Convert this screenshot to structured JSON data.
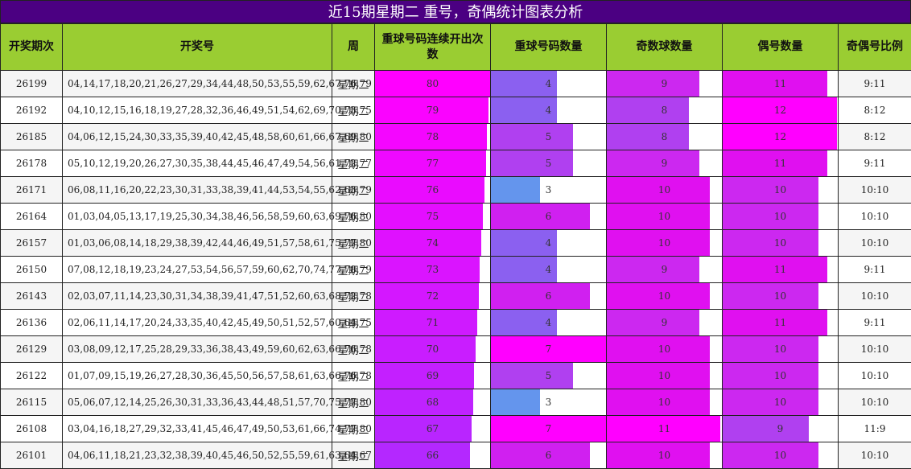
{
  "title": "近15期星期二 重号，奇偶统计图表分析",
  "headers": [
    "开奖期次",
    "开奖号",
    "周",
    "重球号码连续开出次数",
    "重球号码数量",
    "奇数球数量",
    "偶号数量",
    "奇偶号比例"
  ],
  "colors": {
    "title_bg": "#4b0082",
    "header_bg": "#9acd32",
    "magenta": "#ff00ff",
    "violet": "#8a2be2",
    "blue": "#6495ed"
  },
  "chart_data": {
    "type": "table",
    "title": "近15期星期二 重号，奇偶统计图表分析",
    "columns": [
      "开奖期次",
      "开奖号",
      "周",
      "重球号码连续开出次数",
      "重球号码数量",
      "奇数球数量",
      "偶号数量",
      "奇偶号比例"
    ],
    "scales": {
      "consecutive_max": 80,
      "repeat_max": 7,
      "odd_max": 11,
      "even_max": 12
    },
    "rows": [
      {
        "period": "26199",
        "numbers": "04,14,17,18,20,21,26,27,29,34,44,48,50,53,55,59,62,67,76,79",
        "week": "星期二",
        "consecutive": 80,
        "repeat": 4,
        "odd": 9,
        "even": 11,
        "ratio": "9:11"
      },
      {
        "period": "26192",
        "numbers": "04,10,12,15,16,18,19,27,28,32,36,46,49,51,54,62,69,70,73,75",
        "week": "星期二",
        "consecutive": 79,
        "repeat": 4,
        "odd": 8,
        "even": 12,
        "ratio": "8:12"
      },
      {
        "period": "26185",
        "numbers": "04,06,12,15,24,30,33,35,39,40,42,45,48,58,60,61,66,67,69,80",
        "week": "星期二",
        "consecutive": 78,
        "repeat": 5,
        "odd": 8,
        "even": 12,
        "ratio": "8:12"
      },
      {
        "period": "26178",
        "numbers": "05,10,12,19,20,26,27,30,35,38,44,45,46,47,49,54,56,61,72,77",
        "week": "星期二",
        "consecutive": 77,
        "repeat": 5,
        "odd": 9,
        "even": 11,
        "ratio": "9:11"
      },
      {
        "period": "26171",
        "numbers": "06,08,11,16,20,22,23,30,31,33,38,39,41,44,53,54,55,62,63,79",
        "week": "星期二",
        "consecutive": 76,
        "repeat": 3,
        "odd": 10,
        "even": 10,
        "ratio": "10:10"
      },
      {
        "period": "26164",
        "numbers": "01,03,04,05,13,17,19,25,30,34,38,46,56,58,59,60,63,69,76,80",
        "week": "星期二",
        "consecutive": 75,
        "repeat": 6,
        "odd": 10,
        "even": 10,
        "ratio": "10:10"
      },
      {
        "period": "26157",
        "numbers": "01,03,06,08,14,18,29,38,39,42,44,46,49,51,57,58,61,75,77,80",
        "week": "星期二",
        "consecutive": 74,
        "repeat": 4,
        "odd": 10,
        "even": 10,
        "ratio": "10:10"
      },
      {
        "period": "26150",
        "numbers": "07,08,12,18,19,23,24,27,53,54,56,57,59,60,62,70,74,77,78,79",
        "week": "星期二",
        "consecutive": 73,
        "repeat": 4,
        "odd": 9,
        "even": 11,
        "ratio": "9:11"
      },
      {
        "period": "26143",
        "numbers": "02,03,07,11,14,23,30,31,34,38,39,41,47,51,52,60,63,68,72,78",
        "week": "星期二",
        "consecutive": 72,
        "repeat": 6,
        "odd": 10,
        "even": 10,
        "ratio": "10:10"
      },
      {
        "period": "26136",
        "numbers": "02,06,11,14,17,20,24,33,35,40,42,45,49,50,51,52,57,60,64,75",
        "week": "星期二",
        "consecutive": 71,
        "repeat": 4,
        "odd": 9,
        "even": 11,
        "ratio": "9:11"
      },
      {
        "period": "26129",
        "numbers": "03,08,09,12,17,25,28,29,33,36,38,43,49,59,60,62,63,66,76,78",
        "week": "星期二",
        "consecutive": 70,
        "repeat": 7,
        "odd": 10,
        "even": 10,
        "ratio": "10:10"
      },
      {
        "period": "26122",
        "numbers": "01,07,09,15,19,26,27,28,30,36,45,50,56,57,58,61,63,66,76,78",
        "week": "星期二",
        "consecutive": 69,
        "repeat": 5,
        "odd": 10,
        "even": 10,
        "ratio": "10:10"
      },
      {
        "period": "26115",
        "numbers": "05,06,07,12,14,25,26,30,31,33,36,43,44,48,51,57,70,75,77,80",
        "week": "星期二",
        "consecutive": 68,
        "repeat": 3,
        "odd": 10,
        "even": 10,
        "ratio": "10:10"
      },
      {
        "period": "26108",
        "numbers": "03,04,16,18,27,29,32,33,41,45,46,47,49,50,53,61,66,74,77,80",
        "week": "星期二",
        "consecutive": 67,
        "repeat": 7,
        "odd": 11,
        "even": 9,
        "ratio": "11:9"
      },
      {
        "period": "26101",
        "numbers": "04,06,11,18,21,23,32,38,39,40,45,46,50,52,55,59,61,63,64,67",
        "week": "星期二",
        "consecutive": 66,
        "repeat": 6,
        "odd": 10,
        "even": 10,
        "ratio": "10:10"
      }
    ]
  }
}
